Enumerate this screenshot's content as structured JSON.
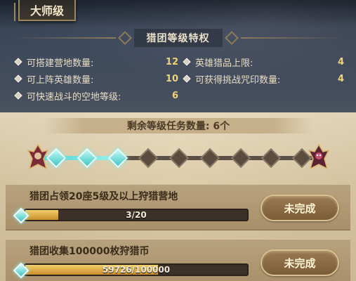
{
  "tier_label": "大师级",
  "privileges_title": "猎团等级特权",
  "benefits": [
    {
      "label": "可搭建营地数量:",
      "value": "12"
    },
    {
      "label": "可上阵英雄数量:",
      "value": "10"
    },
    {
      "label": "可快速战斗的空地等级:",
      "value": "6"
    },
    {
      "label": "英雄猎品上限:",
      "value": "4"
    },
    {
      "label": "可获得挑战咒印数量:",
      "value": "4"
    }
  ],
  "remaining_tasks_text": "剩余等级任务数量: 6个",
  "progress": {
    "total_nodes": 9,
    "completed_nodes": 3
  },
  "tasks": [
    {
      "title": "猎团占领20座5级及以上狩猎营地",
      "progress_text": "3/20",
      "progress": 0.15,
      "status": "未完成"
    },
    {
      "title": "猎团收集100000枚狩猎币",
      "progress_text": "59726/100000",
      "progress": 0.597,
      "status": "未完成"
    }
  ],
  "colors": {
    "accent_cyan": "#4fd4d0",
    "gold": "#f0d27a",
    "bar_fill": "#e2b04f"
  }
}
